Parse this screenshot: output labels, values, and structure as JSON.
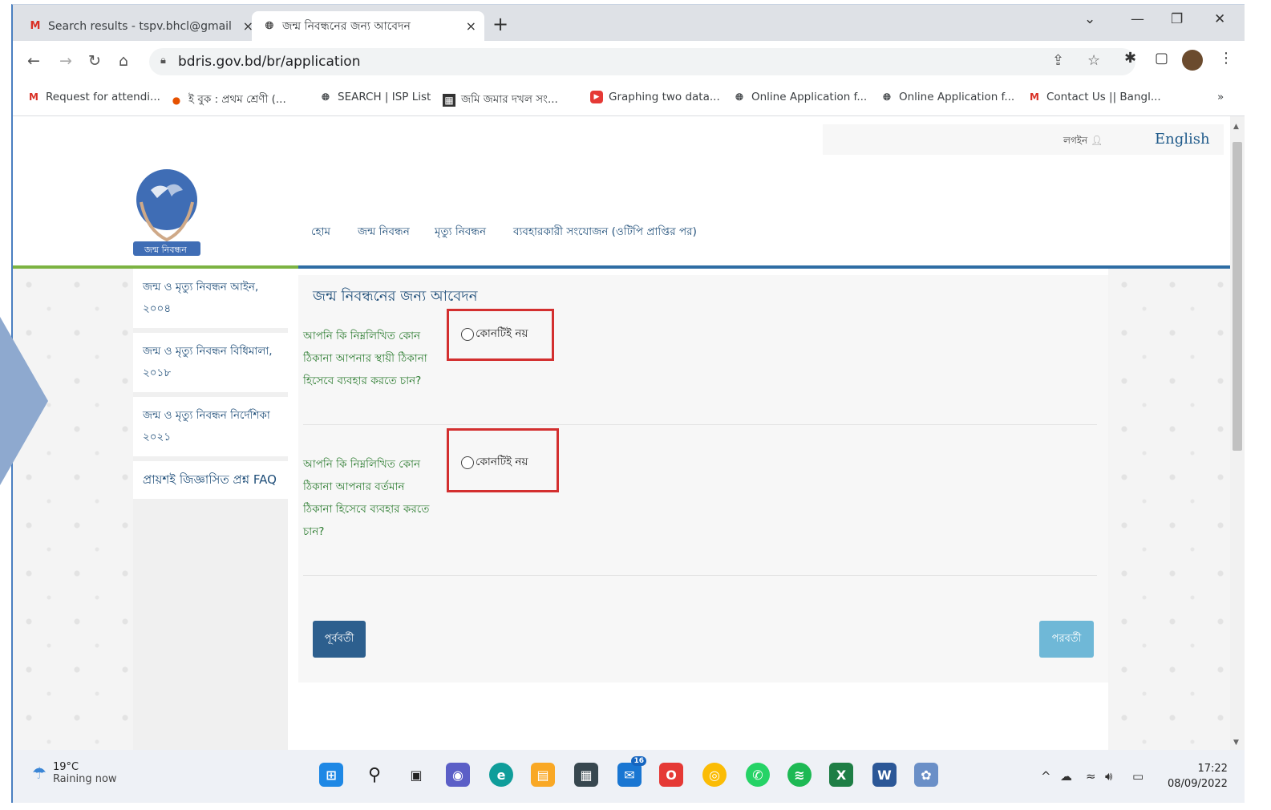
{
  "browser": {
    "tabs": [
      {
        "icon": "gmail-icon",
        "label": "Search results - tspv.bhcl@gmail"
      },
      {
        "icon": "globe-icon",
        "label": "জন্ম নিবন্ধনের জন্য আবেদন"
      }
    ],
    "tab_close": "×",
    "new_tab": "+",
    "url": "bdris.gov.bd/br/application",
    "bookmarks": [
      {
        "icon": "gmail-icon",
        "label": "Request for attendi..."
      },
      {
        "icon": "orange-circle-icon",
        "label": "ই বুক : প্রথম শ্রেণী (..."
      },
      {
        "icon": "globe-icon",
        "label": "SEARCH | ISP List"
      },
      {
        "icon": "map-icon",
        "label": "জমি জমার দখল সং..."
      },
      {
        "icon": "youtube-icon",
        "label": "Graphing two data..."
      },
      {
        "icon": "globe-icon",
        "label": "Online Application f..."
      },
      {
        "icon": "globe-icon",
        "label": "Online Application f..."
      },
      {
        "icon": "gmail-icon",
        "label": "Contact Us || Bangl..."
      }
    ],
    "bookmarks_more": "»"
  },
  "header": {
    "login": "লগইন",
    "language": "English",
    "logo_text": "জন্ম নিবন্ধন",
    "nav": [
      "হোম",
      "জন্ম নিবন্ধন",
      "মৃত্যু নিবন্ধন",
      "ব্যবহারকারী সংযোজন (ওটিপি প্রাপ্তির পর)"
    ]
  },
  "sidebar": {
    "items": [
      "জন্ম ও মৃত্যু নিবন্ধন আইন, ২০০৪",
      "জন্ম ও মৃত্যু নিবন্ধন বিধিমালা, ২০১৮",
      "জন্ম ও মৃত্যু নিবন্ধন নির্দেশিকা ২০২১",
      "প্রায়শই জিজ্ঞাসিত প্রশ্ন FAQ"
    ]
  },
  "form": {
    "title": "জন্ম নিবন্ধনের জন্য আবেদন",
    "q1": "আপনি কি নিম্নলিখিত কোন ঠিকানা আপনার স্থায়ী ঠিকানা হিসেবে ব্যবহার করতে চান?",
    "q1_option": "কোনটিই নয়",
    "q2": "আপনি কি নিম্নলিখিত কোন ঠিকানা আপনার বর্তমান ঠিকানা হিসেবে ব্যবহার করতে চান?",
    "q2_option": "কোনটিই নয়",
    "prev": "পূর্ববর্তী",
    "next": "পরবর্তী",
    "highlight_color": "#d32f2f"
  },
  "taskbar": {
    "temperature": "19°C",
    "weather": "Raining now",
    "mail_badge": "16",
    "time": "17:22",
    "date": "08/09/2022"
  }
}
